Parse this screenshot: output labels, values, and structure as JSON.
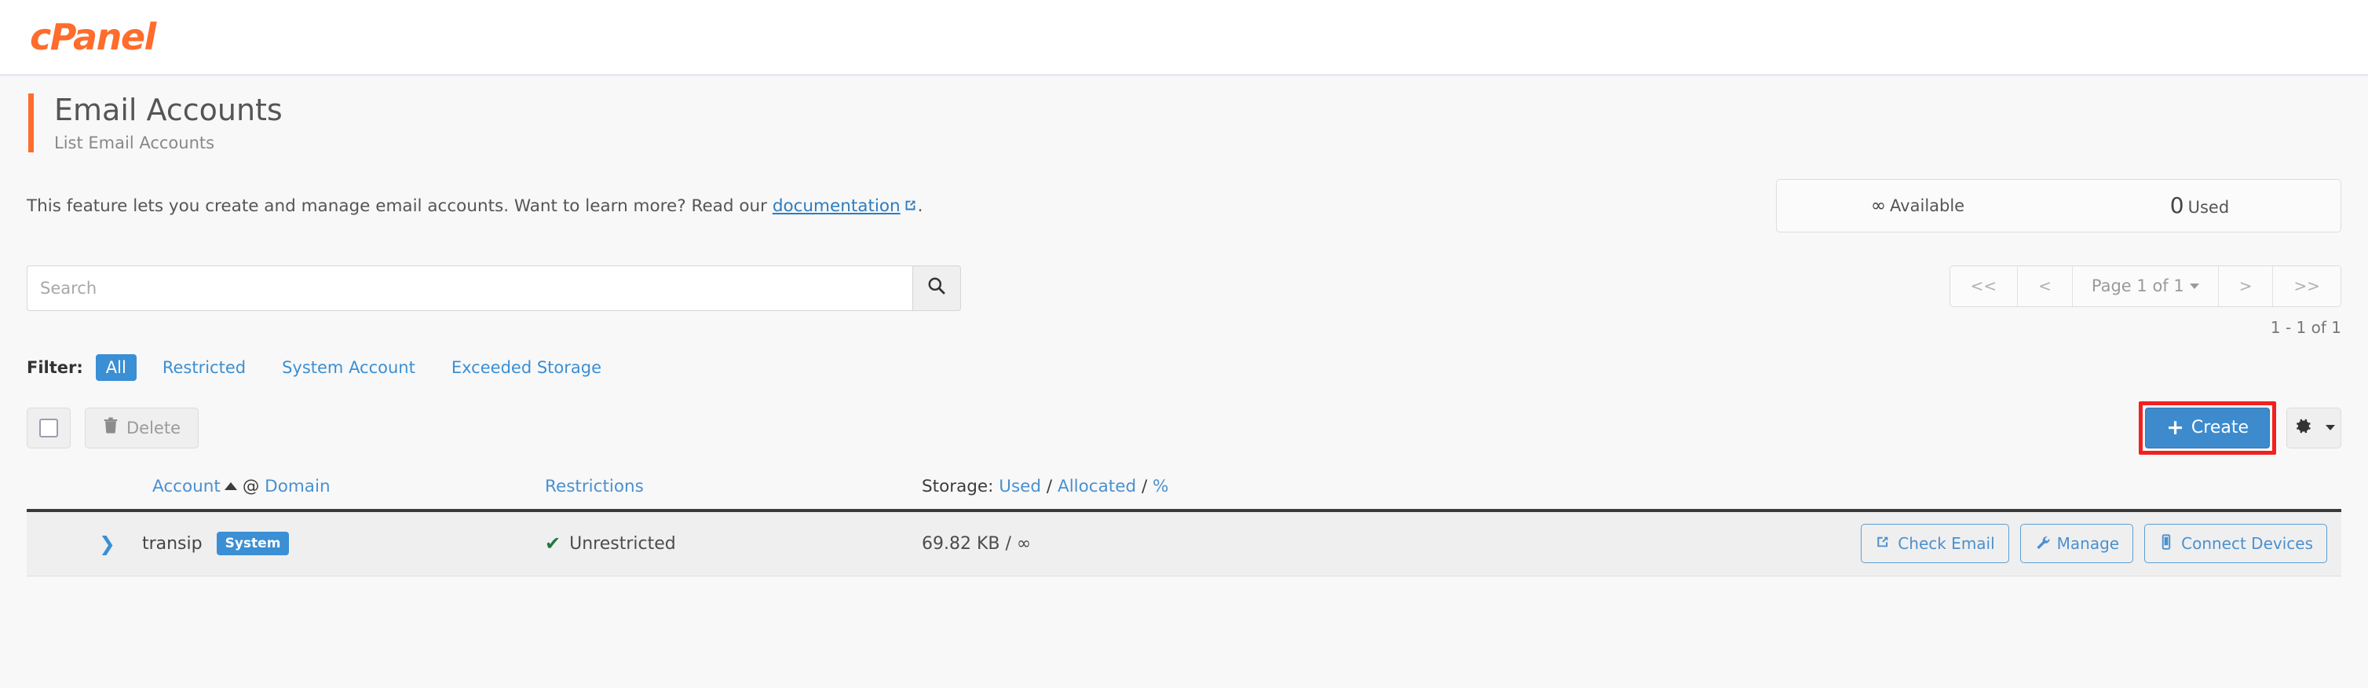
{
  "brand": {
    "logo_text": "cPanel"
  },
  "header": {
    "title": "Email Accounts",
    "subtitle": "List Email Accounts"
  },
  "description": {
    "text_before": "This feature lets you create and manage email accounts. Want to learn more? Read our",
    "link_label": "documentation",
    "text_after": "."
  },
  "stats": {
    "available_value": "∞",
    "available_label": "Available",
    "used_value": "0",
    "used_label": "Used"
  },
  "search": {
    "placeholder": "Search",
    "value": "",
    "icon": "search-icon"
  },
  "pagination": {
    "first_label": "<<",
    "prev_label": "<",
    "page_label": "Page 1 of 1",
    "next_label": ">",
    "last_label": ">>",
    "range_label": "1 - 1 of 1"
  },
  "filter": {
    "label": "Filter:",
    "items": [
      {
        "label": "All",
        "active": true
      },
      {
        "label": "Restricted",
        "active": false
      },
      {
        "label": "System Account",
        "active": false
      },
      {
        "label": "Exceeded Storage",
        "active": false
      }
    ]
  },
  "actions": {
    "select_all_icon": "checkbox-icon",
    "delete_label": "Delete",
    "delete_icon": "trash-icon",
    "create_label": "Create",
    "create_icon": "plus-icon",
    "settings_icon": "gear-icon",
    "highlight_color": "#f32020",
    "create_color": "#3d8bcd"
  },
  "table": {
    "headers": {
      "account": "Account",
      "at": "@",
      "domain": "Domain",
      "restrictions": "Restrictions",
      "storage_label": "Storage:",
      "storage_used": "Used",
      "storage_sep1": "/",
      "storage_allocated": "Allocated",
      "storage_sep2": "/",
      "storage_percent": "%",
      "sort_direction": "asc"
    },
    "rows": [
      {
        "expand_icon": "chevron-right-icon",
        "account": "transip",
        "badge": "System",
        "restriction_icon": "check-icon",
        "restriction": "Unrestricted",
        "storage": "69.82 KB / ∞",
        "actions": [
          {
            "label": "Check Email",
            "icon": "external-link-icon"
          },
          {
            "label": "Manage",
            "icon": "wrench-icon"
          },
          {
            "label": "Connect Devices",
            "icon": "mobile-icon"
          }
        ]
      }
    ]
  }
}
